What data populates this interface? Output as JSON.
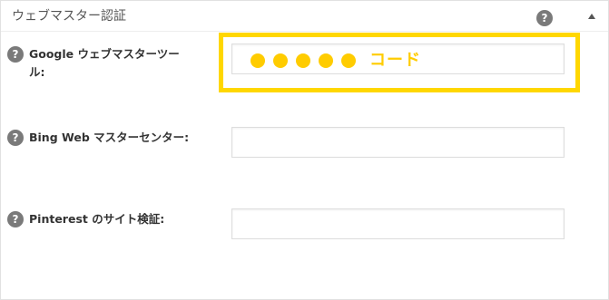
{
  "panel": {
    "title": "ウェブマスター認証",
    "collapse_glyph": "▲",
    "collapse_icon": "triangle-up-icon",
    "help_icon": "question-circle-icon",
    "help_glyph": "?"
  },
  "fields": [
    {
      "label": "Google ウェブマスターツール:",
      "value": "",
      "placeholder": ""
    },
    {
      "label": "Bing Web マスターセンター:",
      "value": "",
      "placeholder": ""
    },
    {
      "label": "Pinterest のサイト検証:",
      "value": "",
      "placeholder": ""
    }
  ],
  "annotation": {
    "dot_count": 5,
    "text": "コード",
    "highlight_color": "#ffd700",
    "text_color": "#ffcc00"
  },
  "colors": {
    "help_icon_bg": "#7a7a7a",
    "border": "#dddddd",
    "label_text": "#333333"
  }
}
